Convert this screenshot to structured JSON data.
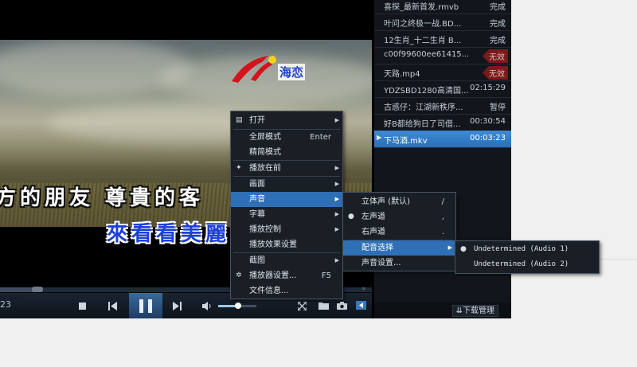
{
  "video": {
    "logo_text": "海恋",
    "lyric_line1": "方的朋友 尊貴的客",
    "lyric_line2": "來看看美麗"
  },
  "controls": {
    "time_fragment": "23",
    "stop_icon": "stop-icon",
    "prev_icon": "previous-icon",
    "pause_icon": "pause-icon",
    "next_icon": "next-icon",
    "volume_icon": "volume-icon",
    "volume_level": 0.5,
    "fullscreen_icon": "fullscreen-icon",
    "folder_icon": "folder-icon",
    "camera_icon": "camera-icon",
    "panel_icon": "panel-toggle-icon"
  },
  "playlist": {
    "items": [
      {
        "name": "喜探_最新首发.rmvb",
        "status": "完成",
        "style": "normal"
      },
      {
        "name": "叶问之终极一战.BD...",
        "status": "完成",
        "style": "normal"
      },
      {
        "name": "12生肖_十二生肖 B...",
        "status": "完成",
        "style": "normal"
      },
      {
        "name": "c00f99600ee61415...",
        "status": "无效",
        "style": "invalid"
      },
      {
        "name": "天路.mp4",
        "status": "无效",
        "style": "invalid"
      },
      {
        "name": "YDZSBD1280高清国...",
        "status": "02:15:29",
        "style": "normal"
      },
      {
        "name": "古惑仔：江湖新秩序...",
        "status": "暂停",
        "style": "normal"
      },
      {
        "name": "好B都给狗日了司借...",
        "status": "00:30:54",
        "style": "normal"
      },
      {
        "name": "下马酒.mkv",
        "status": "00:03:23",
        "style": "selected"
      }
    ],
    "download_button": "下载管理"
  },
  "context_menu": {
    "open": "打开",
    "fullscreen": "全屏模式",
    "fullscreen_shortcut": "Enter",
    "compact": "精简模式",
    "on_top": "播放在前",
    "picture": "画面",
    "sound": "声音",
    "subtitle": "字幕",
    "playback_control": "播放控制",
    "effects": "播放效果设置",
    "screenshot": "截图",
    "player_settings": "播放器设置...",
    "player_settings_shortcut": "F5",
    "file_info": "文件信息..."
  },
  "sound_menu": {
    "stereo": "立体声 (默认)",
    "stereo_shortcut": "/",
    "left": "左声道",
    "left_shortcut": ",",
    "right": "右声道",
    "right_shortcut": ".",
    "dub_select": "配音选择",
    "sound_settings": "声音设置..."
  },
  "dub_menu": {
    "audio1": "Undetermined (Audio 1)",
    "audio2": "Undetermined (Audio 2)"
  }
}
